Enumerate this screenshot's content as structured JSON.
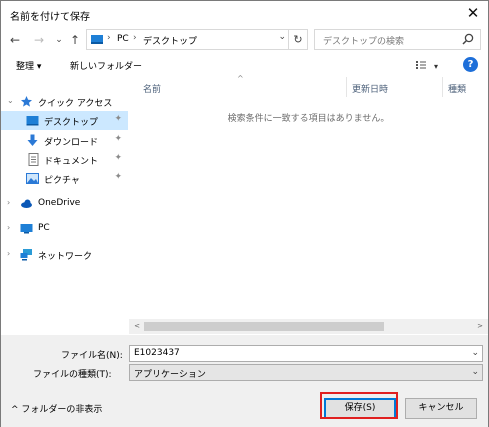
{
  "window": {
    "title": "名前を付けて保存",
    "close_glyph": "✕"
  },
  "nav": {
    "back": "←",
    "forward": "→",
    "dropdown": "⌄",
    "up": "↑"
  },
  "address": {
    "crumbs": [
      "PC",
      "デスクトップ"
    ],
    "separator": "›",
    "dropdown": "⌄",
    "refresh": "↻"
  },
  "search": {
    "placeholder": "デスクトップの検索"
  },
  "toolbar": {
    "organize": "整理 ▾",
    "new_folder": "新しいフォルダー",
    "view_dd": "▾",
    "help": "?"
  },
  "sidebar": {
    "items": [
      {
        "label": "クイック アクセス",
        "icon": "star-icon"
      },
      {
        "label": "デスクトップ",
        "icon": "desktop-icon",
        "pinned": true,
        "selected": true
      },
      {
        "label": "ダウンロード",
        "icon": "download-icon",
        "pinned": true
      },
      {
        "label": "ドキュメント",
        "icon": "document-icon",
        "pinned": true
      },
      {
        "label": "ピクチャ",
        "icon": "pictures-icon",
        "pinned": true
      },
      {
        "label": "OneDrive",
        "icon": "cloud-icon"
      },
      {
        "label": "PC",
        "icon": "pc-icon"
      },
      {
        "label": "ネットワーク",
        "icon": "network-icon"
      }
    ],
    "expand_glyph": "›",
    "collapse_glyph": "⌄",
    "pin_glyph": "📌"
  },
  "file_list": {
    "columns": [
      "名前",
      "更新日時",
      "種類"
    ],
    "sort_arrow": "^",
    "empty_message": "検索条件に一致する項目はありません。"
  },
  "scrollbar": {
    "left": "<",
    "right": ">"
  },
  "form": {
    "filename_label": "ファイル名(N):",
    "filename_value": "E1023437",
    "filetype_label": "ファイルの種類(T):",
    "filetype_value": "アプリケーション",
    "dropdown": "⌄"
  },
  "footer": {
    "hide_folders": "^ フォルダーの非表示",
    "save": "保存(S)",
    "cancel": "キャンセル"
  },
  "colors": {
    "accent": "#0078d7",
    "selection": "#cce8ff",
    "highlight": "#e02020"
  }
}
